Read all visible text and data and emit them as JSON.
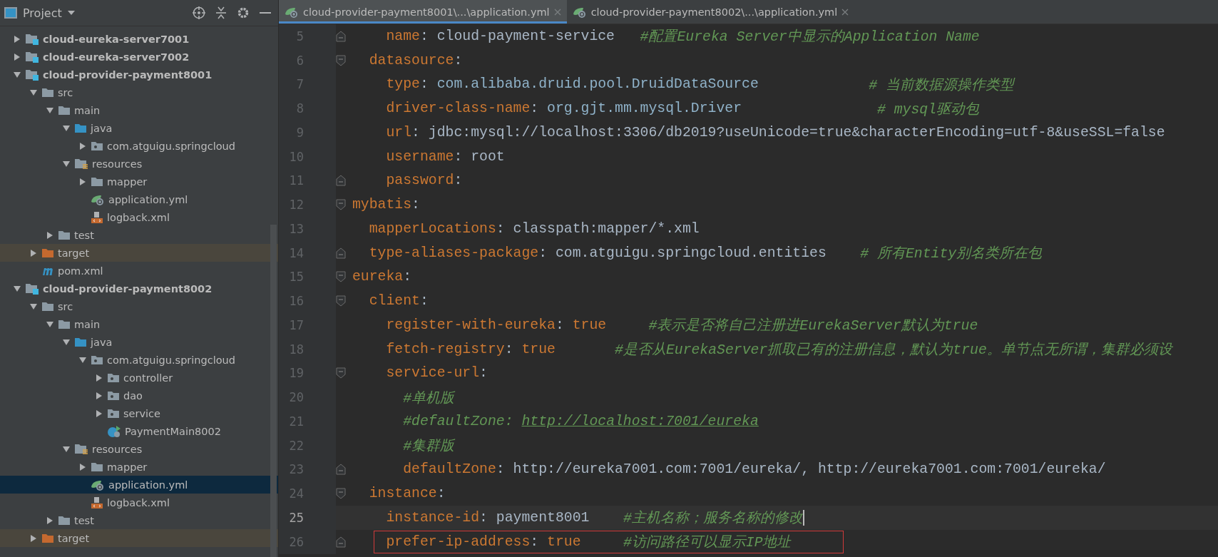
{
  "project_panel": {
    "title": "Project"
  },
  "tree": [
    {
      "label": "cloud-eureka-server7001",
      "kind": "module",
      "expanded": false,
      "selected": false
    },
    {
      "label": "cloud-eureka-server7002",
      "kind": "module",
      "expanded": false,
      "selected": false
    },
    {
      "label": "cloud-provider-payment8001",
      "kind": "module",
      "expanded": true,
      "selected": false,
      "children": [
        {
          "label": "src",
          "kind": "folder",
          "expanded": true,
          "selected": false,
          "children": [
            {
              "label": "main",
              "kind": "folder",
              "expanded": true,
              "selected": false,
              "children": [
                {
                  "label": "java",
                  "kind": "source-folder",
                  "expanded": true,
                  "selected": false,
                  "children": [
                    {
                      "label": "com.atguigu.springcloud",
                      "kind": "package",
                      "expanded": false,
                      "selected": false
                    }
                  ]
                },
                {
                  "label": "resources",
                  "kind": "resources",
                  "expanded": true,
                  "selected": false,
                  "children": [
                    {
                      "label": "mapper",
                      "kind": "folder",
                      "expanded": false,
                      "selected": false
                    },
                    {
                      "label": "application.yml",
                      "kind": "spring-yml",
                      "selected": false
                    },
                    {
                      "label": "logback.xml",
                      "kind": "xml",
                      "selected": false
                    }
                  ]
                }
              ]
            },
            {
              "label": "test",
              "kind": "folder",
              "expanded": false,
              "selected": false
            }
          ]
        },
        {
          "label": "target",
          "kind": "excluded",
          "expanded": false,
          "selected": false
        },
        {
          "label": "pom.xml",
          "kind": "maven",
          "selected": false
        }
      ]
    },
    {
      "label": "cloud-provider-payment8002",
      "kind": "module",
      "expanded": true,
      "selected": false,
      "children": [
        {
          "label": "src",
          "kind": "folder",
          "expanded": true,
          "selected": false,
          "children": [
            {
              "label": "main",
              "kind": "folder",
              "expanded": true,
              "selected": false,
              "children": [
                {
                  "label": "java",
                  "kind": "source-folder",
                  "expanded": true,
                  "selected": false,
                  "children": [
                    {
                      "label": "com.atguigu.springcloud",
                      "kind": "package",
                      "expanded": true,
                      "selected": false,
                      "children": [
                        {
                          "label": "controller",
                          "kind": "package",
                          "expanded": false,
                          "selected": false
                        },
                        {
                          "label": "dao",
                          "kind": "package",
                          "expanded": false,
                          "selected": false
                        },
                        {
                          "label": "service",
                          "kind": "package",
                          "expanded": false,
                          "selected": false
                        },
                        {
                          "label": "PaymentMain8002",
                          "kind": "spring-class",
                          "selected": false
                        }
                      ]
                    }
                  ]
                },
                {
                  "label": "resources",
                  "kind": "resources",
                  "expanded": true,
                  "selected": false,
                  "children": [
                    {
                      "label": "mapper",
                      "kind": "folder",
                      "expanded": false,
                      "selected": false
                    },
                    {
                      "label": "application.yml",
                      "kind": "spring-yml",
                      "selected": true
                    },
                    {
                      "label": "logback.xml",
                      "kind": "xml",
                      "selected": false
                    }
                  ]
                }
              ]
            },
            {
              "label": "test",
              "kind": "folder",
              "expanded": false,
              "selected": false
            }
          ]
        },
        {
          "label": "target",
          "kind": "excluded",
          "expanded": false,
          "selected": false
        }
      ]
    }
  ],
  "tabs": [
    {
      "label": "cloud-provider-payment8001\\...\\application.yml",
      "selected": true
    },
    {
      "label": "cloud-provider-payment8002\\...\\application.yml",
      "selected": false
    }
  ],
  "lines": [
    {
      "number": "5",
      "fold_end": true,
      "segments": [
        {
          "kind": "key",
          "text": "    name"
        },
        {
          "kind": "plain",
          "text": ": cloud-payment-service   "
        },
        {
          "kind": "comment",
          "text": "#配置Eureka Server中显示的Application Name"
        }
      ]
    },
    {
      "number": "6",
      "fold_start": true,
      "segments": [
        {
          "kind": "key",
          "text": "  datasource"
        },
        {
          "kind": "plain",
          "text": ":"
        }
      ]
    },
    {
      "number": "7",
      "segments": [
        {
          "kind": "key",
          "text": "    type"
        },
        {
          "kind": "plain",
          "text": ": "
        },
        {
          "kind": "class",
          "text": "com.alibaba.druid.pool.DruidDataSource"
        },
        {
          "kind": "comment",
          "text": "             # 当前数据源操作类型"
        }
      ]
    },
    {
      "number": "8",
      "segments": [
        {
          "kind": "key",
          "text": "    driver-class-name"
        },
        {
          "kind": "plain",
          "text": ": "
        },
        {
          "kind": "class",
          "text": "org.gjt.mm.mysql.Driver"
        },
        {
          "kind": "comment",
          "text": "                # mysql驱动包"
        }
      ]
    },
    {
      "number": "9",
      "segments": [
        {
          "kind": "key",
          "text": "    url"
        },
        {
          "kind": "plain",
          "text": ": jdbc:mysql://localhost:3306/db2019?useUnicode=true&characterEncoding=utf-8&useSSL=false"
        }
      ]
    },
    {
      "number": "10",
      "segments": [
        {
          "kind": "key",
          "text": "    username"
        },
        {
          "kind": "plain",
          "text": ": root"
        }
      ]
    },
    {
      "number": "11",
      "fold_end": true,
      "segments": [
        {
          "kind": "key",
          "text": "    password"
        },
        {
          "kind": "plain",
          "text": ":"
        }
      ]
    },
    {
      "number": "12",
      "fold_start": true,
      "segments": [
        {
          "kind": "key",
          "text": "mybatis"
        },
        {
          "kind": "plain",
          "text": ":"
        }
      ]
    },
    {
      "number": "13",
      "segments": [
        {
          "kind": "key",
          "text": "  mapperLocations"
        },
        {
          "kind": "plain",
          "text": ": classpath:mapper/*.xml"
        }
      ]
    },
    {
      "number": "14",
      "fold_end": true,
      "segments": [
        {
          "kind": "key",
          "text": "  type-aliases-package"
        },
        {
          "kind": "plain",
          "text": ": com.atguigu.springcloud.entities    "
        },
        {
          "kind": "comment",
          "text": "# 所有Entity别名类所在包"
        }
      ]
    },
    {
      "number": "15",
      "fold_start": true,
      "segments": [
        {
          "kind": "key",
          "text": "eureka"
        },
        {
          "kind": "plain",
          "text": ":"
        }
      ]
    },
    {
      "number": "16",
      "fold_start": true,
      "segments": [
        {
          "kind": "key",
          "text": "  client"
        },
        {
          "kind": "plain",
          "text": ":"
        }
      ]
    },
    {
      "number": "17",
      "segments": [
        {
          "kind": "key",
          "text": "    register-with-eureka"
        },
        {
          "kind": "plain",
          "text": ": "
        },
        {
          "kind": "bool",
          "text": "true"
        },
        {
          "kind": "comment",
          "text": "     #表示是否将自己注册进EurekaServer默认为true"
        }
      ]
    },
    {
      "number": "18",
      "segments": [
        {
          "kind": "key",
          "text": "    fetch-registry"
        },
        {
          "kind": "plain",
          "text": ": "
        },
        {
          "kind": "bool",
          "text": "true"
        },
        {
          "kind": "comment",
          "text": "       #是否从EurekaServer抓取已有的注册信息，默认为true。单节点无所谓，集群必须设"
        }
      ]
    },
    {
      "number": "19",
      "fold_start": true,
      "segments": [
        {
          "kind": "key",
          "text": "    service-url"
        },
        {
          "kind": "plain",
          "text": ":"
        }
      ]
    },
    {
      "number": "20",
      "segments": [
        {
          "kind": "comment",
          "text": "      #单机版"
        }
      ]
    },
    {
      "number": "21",
      "segments": [
        {
          "kind": "comment",
          "text": "      #defaultZone: "
        },
        {
          "kind": "link",
          "text": "http://localhost:7001/eureka"
        }
      ]
    },
    {
      "number": "22",
      "segments": [
        {
          "kind": "comment",
          "text": "      #集群版"
        }
      ]
    },
    {
      "number": "23",
      "fold_end": true,
      "segments": [
        {
          "kind": "key",
          "text": "      defaultZone"
        },
        {
          "kind": "plain",
          "text": ": http://eureka7001.com:7001/eureka/, http://eureka7001.com:7001/eureka/"
        }
      ]
    },
    {
      "number": "24",
      "fold_start": true,
      "segments": [
        {
          "kind": "key",
          "text": "  instance"
        },
        {
          "kind": "plain",
          "text": ":"
        }
      ]
    },
    {
      "number": "25",
      "current": true,
      "segments": [
        {
          "kind": "key",
          "text": "    instance-id"
        },
        {
          "kind": "plain",
          "text": ": payment8001    "
        },
        {
          "kind": "comment",
          "text": "#主机名称；服务名称的修改"
        }
      ]
    },
    {
      "number": "26",
      "fold_end": true,
      "highlighted": true,
      "segments": [
        {
          "kind": "key",
          "text": "    prefer-ip-address"
        },
        {
          "kind": "plain",
          "text": ": "
        },
        {
          "kind": "bool",
          "text": "true"
        },
        {
          "kind": "comment",
          "text": "     #访问路径可以显示IP地址"
        }
      ]
    }
  ]
}
